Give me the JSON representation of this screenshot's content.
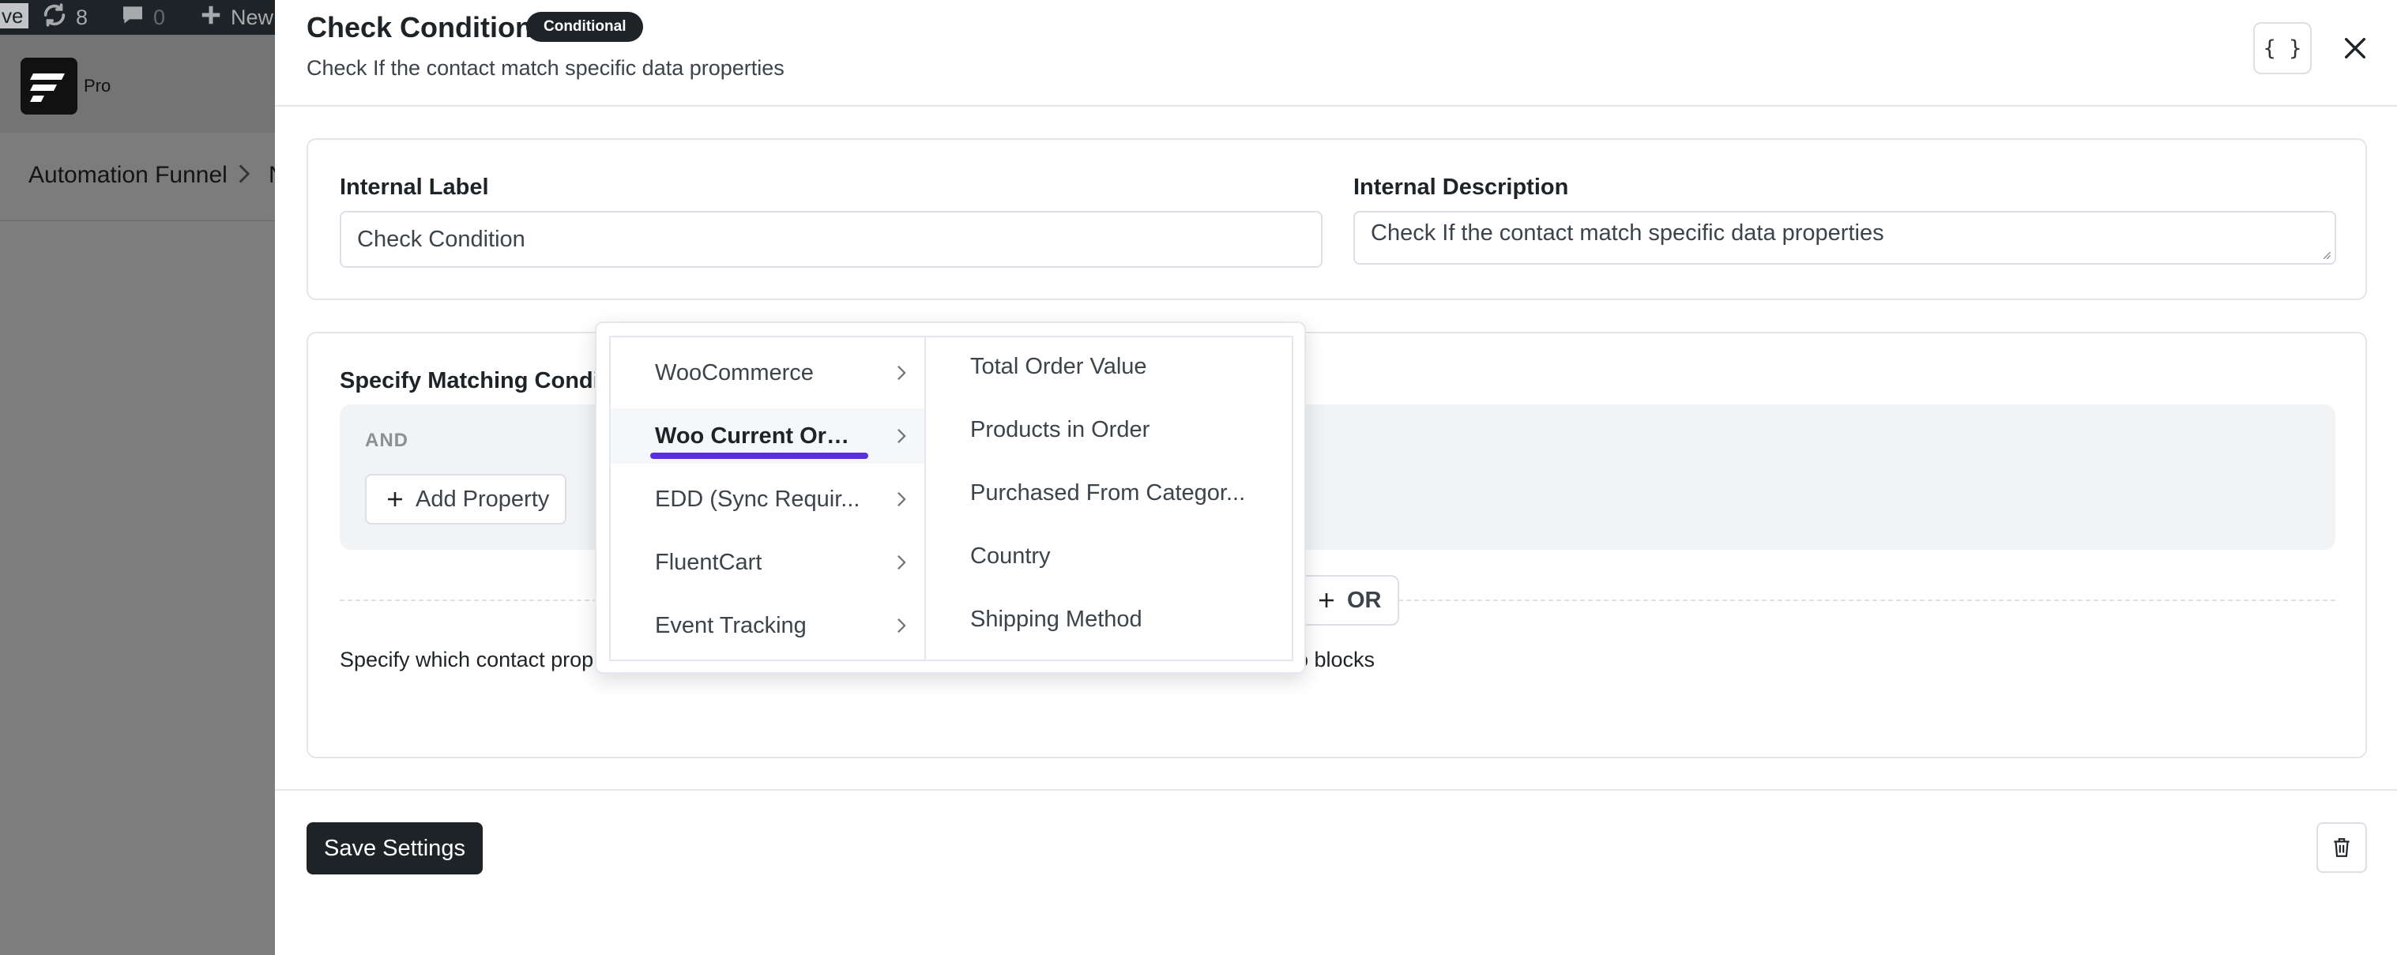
{
  "admin_bar": {
    "live_label": "ve",
    "updates_count": "8",
    "comments_count": "0",
    "new_label": "New"
  },
  "background": {
    "logo_suffix": "Pro",
    "breadcrumb_root": "Automation Funnel",
    "breadcrumb_next": "N"
  },
  "drawer": {
    "title": "Check Condition",
    "badge": "Conditional",
    "subtitle": "Check If the contact match specific data properties",
    "json_button_label": "{ }",
    "internal_label": {
      "label": "Internal Label",
      "value": "Check Condition"
    },
    "internal_description": {
      "label": "Internal Description",
      "value": "Check If the contact match specific data properties"
    },
    "conditions": {
      "title": "Specify Matching Conditi",
      "and_label": "AND",
      "add_property_label": "Add Property",
      "or_label": "OR",
      "help_text_start": "Specify which contact prop",
      "help_text_end": "o blocks"
    },
    "save_label": "Save Settings"
  },
  "cascader": {
    "groups": [
      {
        "label": "WooCommerce"
      },
      {
        "label": "Woo Current Order"
      },
      {
        "label": "EDD (Sync Requir..."
      },
      {
        "label": "FluentCart"
      },
      {
        "label": "Event Tracking"
      }
    ],
    "active_group_index": 1,
    "options": [
      {
        "label": "Total Order Value"
      },
      {
        "label": "Products in Order"
      },
      {
        "label": "Purchased From Categor..."
      },
      {
        "label": "Country"
      },
      {
        "label": "Shipping Method"
      }
    ]
  },
  "colors": {
    "accent_underline": "#5b2ee0",
    "dark": "#1d2327"
  },
  "icons": {
    "updates": "refresh-icon",
    "comments": "comment-icon",
    "new": "plus-icon",
    "close": "close-icon",
    "trash": "trash-icon",
    "chevron": "chevron-right-icon"
  }
}
